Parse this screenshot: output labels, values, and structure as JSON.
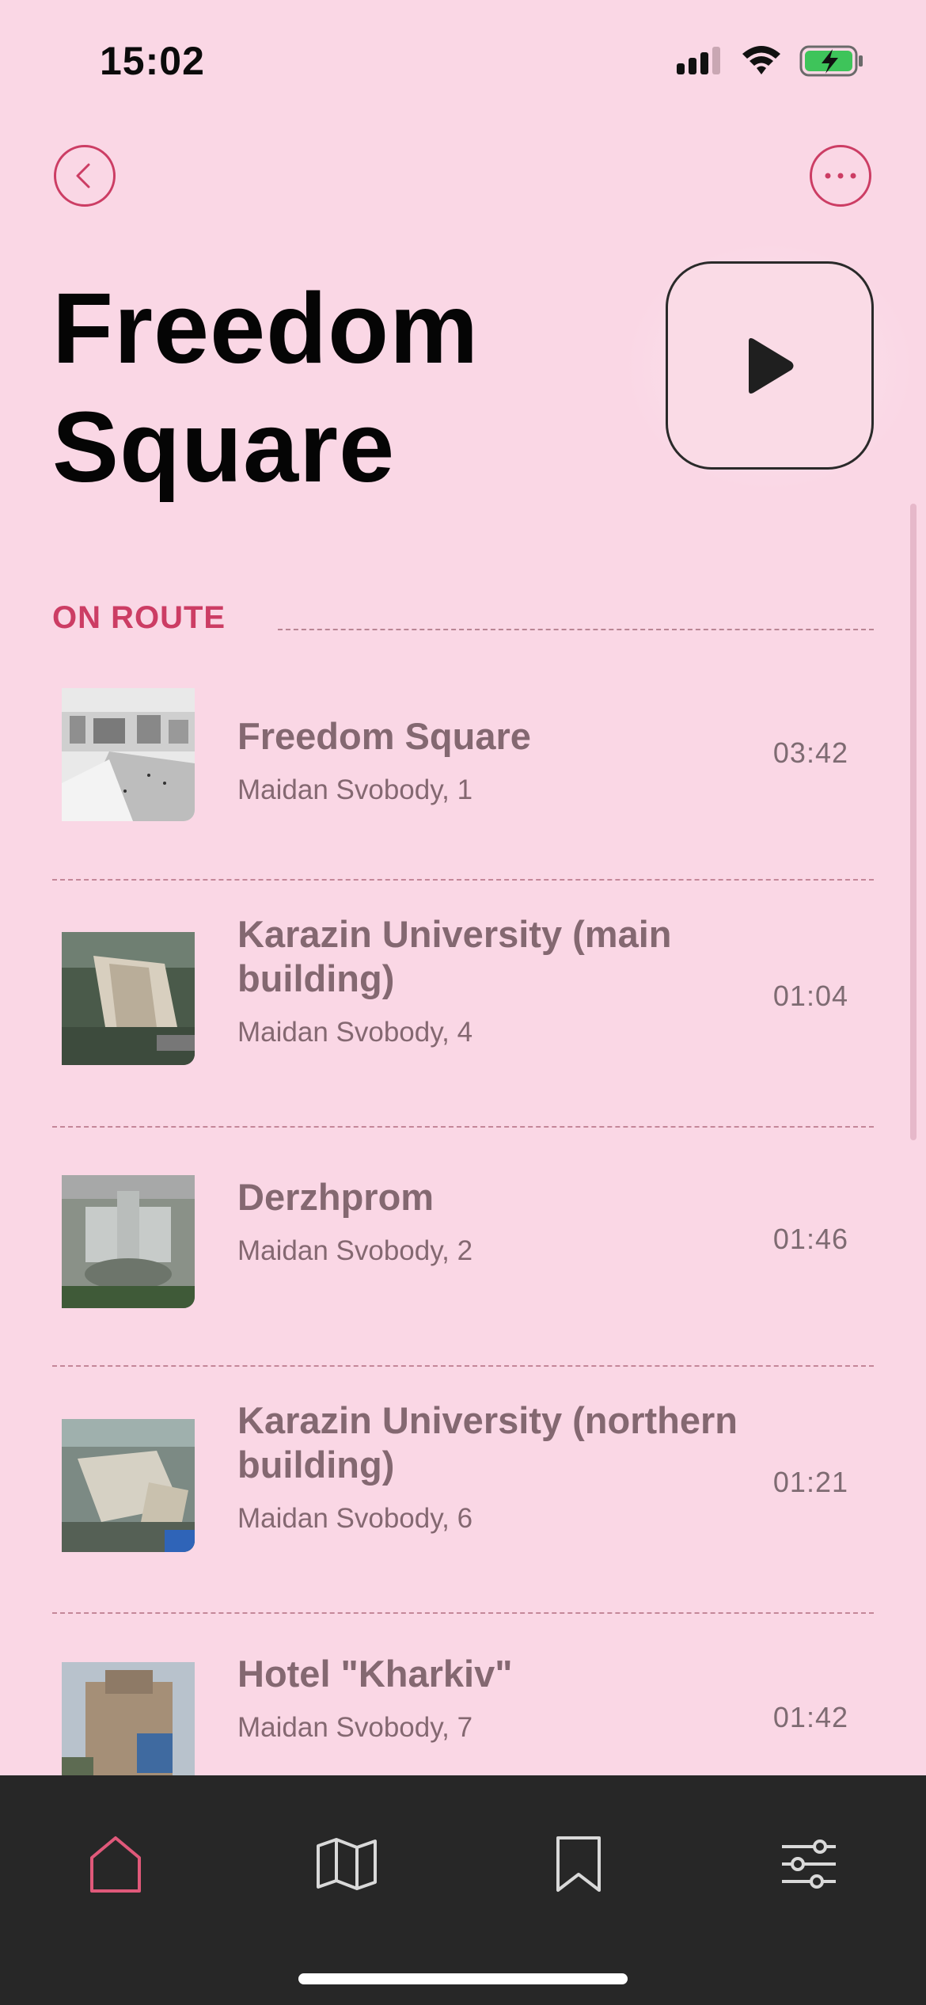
{
  "status_bar": {
    "time": "15:02",
    "icons": [
      "signal-icon",
      "wifi-icon",
      "battery-charging-icon"
    ]
  },
  "header": {
    "back_icon": "chevron-left-icon",
    "more_icon": "ellipsis-icon",
    "title_line1": "Freedom",
    "title_line2": "Square",
    "play_icon": "play-icon"
  },
  "section": {
    "label": "ON ROUTE"
  },
  "route_items": [
    {
      "name": "Freedom Square",
      "address": "Maidan Svobody, 1",
      "duration": "03:42"
    },
    {
      "name": "Karazin University (main building)",
      "address": "Maidan Svobody, 4",
      "duration": "01:04"
    },
    {
      "name": "Derzhprom",
      "address": "Maidan Svobody, 2",
      "duration": "01:46"
    },
    {
      "name": "Karazin University (northern building)",
      "address": "Maidan Svobody, 6",
      "duration": "01:21"
    },
    {
      "name": "Hotel \"Kharkiv\"",
      "address": "Maidan Svobody, 7",
      "duration": "01:42"
    }
  ],
  "tab_bar": {
    "tabs": [
      "home-icon",
      "map-icon",
      "bookmark-icon",
      "settings-sliders-icon"
    ],
    "active_color": "#e0597a",
    "inactive_color": "#d9d9d9"
  },
  "colors": {
    "background": "#fad7e5",
    "accent": "#cc3d64",
    "tab_bar": "#272727"
  }
}
